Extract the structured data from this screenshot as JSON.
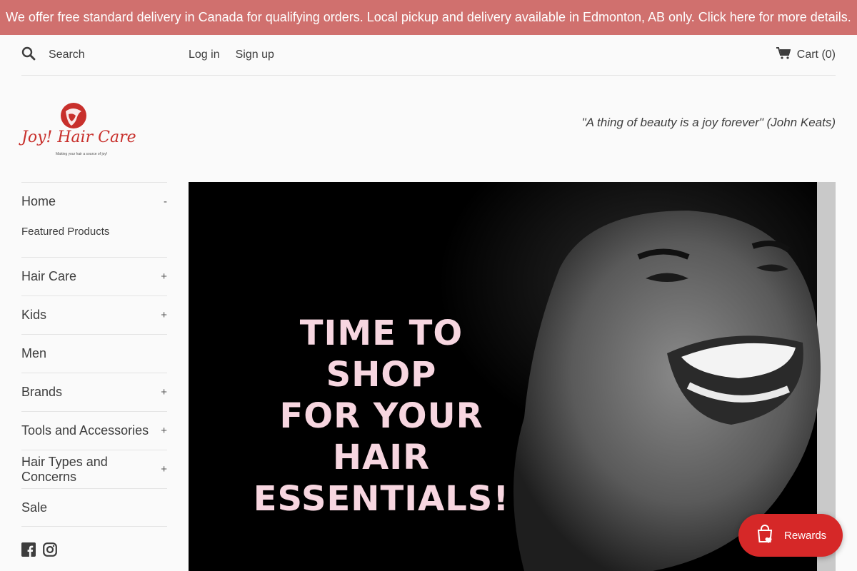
{
  "announcement": "We offer free standard delivery in Canada for qualifying orders. Local pickup and delivery available in Edmonton, AB only. Click here for more details.",
  "header": {
    "search_placeholder": "Search",
    "login": "Log in",
    "signup": "Sign up",
    "cart": "Cart (0)"
  },
  "logo": {
    "name": "Joy! Hair Care",
    "tagline": "Making your hair a source of joy!"
  },
  "quote": "\"A thing of beauty is a joy forever\" (John Keats)",
  "sidebar": {
    "home": {
      "label": "Home",
      "toggle": "-"
    },
    "home_sub": "Featured Products",
    "items": [
      {
        "label": "Hair Care",
        "toggle": "+"
      },
      {
        "label": "Kids",
        "toggle": "+"
      },
      {
        "label": "Men",
        "toggle": ""
      },
      {
        "label": "Brands",
        "toggle": "+"
      },
      {
        "label": "Tools and Accessories",
        "toggle": "+"
      },
      {
        "label": "Hair Types and Concerns",
        "toggle": "+"
      },
      {
        "label": "Sale",
        "toggle": ""
      }
    ]
  },
  "hero": {
    "line1": "TIME TO SHOP",
    "line2": "FOR YOUR",
    "line3": "HAIR",
    "line4": "ESSENTIALS!"
  },
  "rewards": "Rewards",
  "colors": {
    "announcement_bg": "#d0706e",
    "brand_red": "#c8302c",
    "rewards_bg": "#d62828",
    "hero_text": "#f7d6e0"
  }
}
